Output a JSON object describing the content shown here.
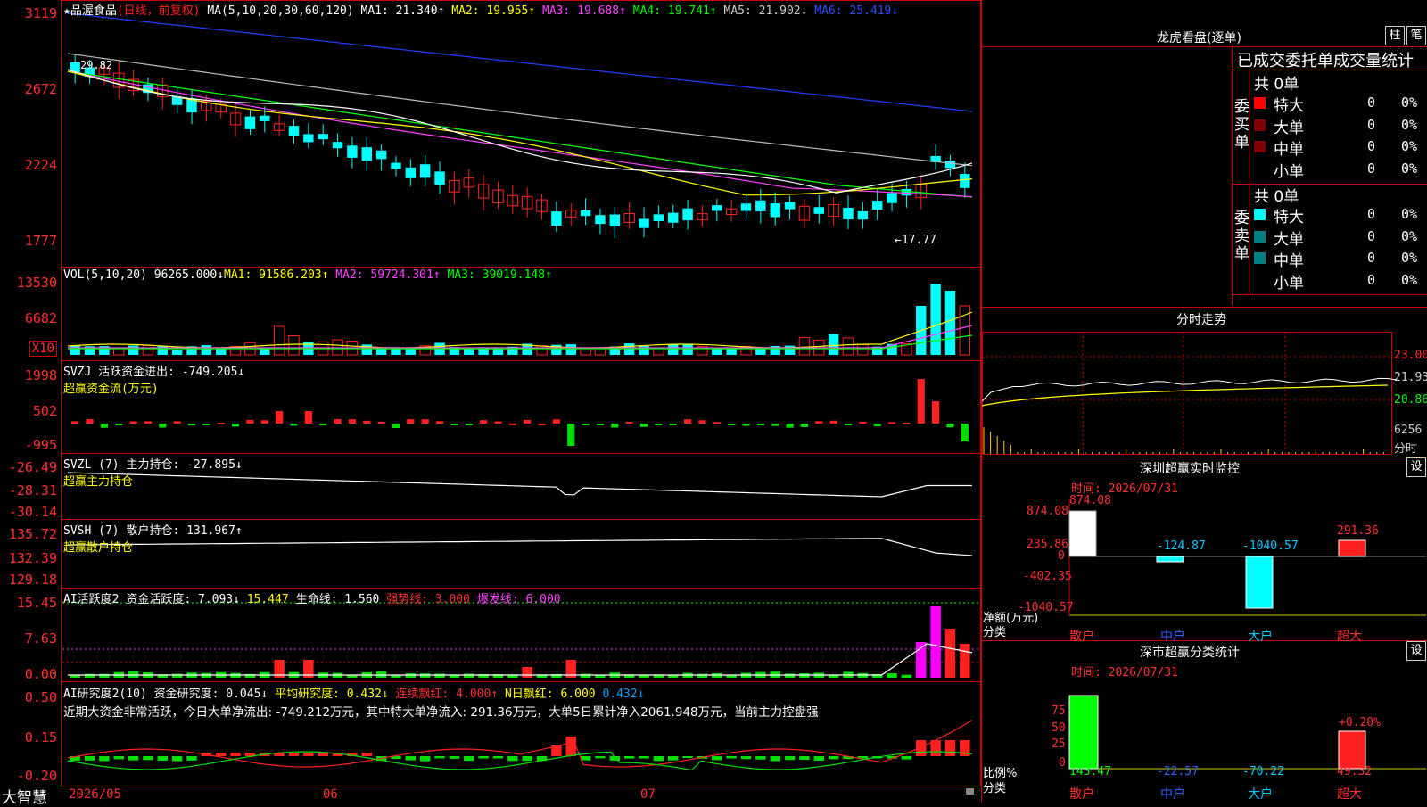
{
  "app_name": "大智慧",
  "main_chart": {
    "title_stock": "★品渥食品",
    "title_mode": "(日线，前复权)",
    "ma_label": "MA(5,10,20,30,60,120)",
    "ma1": "MA1: 21.340↑",
    "ma2": "MA2: 19.955↑",
    "ma3": "MA3: 19.688↑",
    "ma4": "MA4: 19.741↑",
    "ma5": "MA5: 21.902↓",
    "ma6": "MA6: 25.419↓",
    "y_ticks": [
      "3119",
      "2672",
      "2224",
      "1777"
    ],
    "high_label": "29.82",
    "low_label": "←17.77"
  },
  "vol_panel": {
    "label": "VOL(5,10,20)",
    "value": "96265.000↓",
    "ma1": "MA1: 91586.203↑",
    "ma2": "MA2: 59724.301↑",
    "ma3": "MA3: 39019.148↑",
    "y_ticks": [
      "13530",
      "6682"
    ],
    "unit": "X10"
  },
  "svzj_panel": {
    "label": "SVZJ",
    "value": "活跃资金进出: -749.205↓",
    "sub": "超赢资金流(万元)",
    "y_ticks": [
      "1998",
      "502",
      "-995"
    ]
  },
  "svzl_panel": {
    "label": "SVZL (7)",
    "value": "主力持仓: -27.895↓",
    "sub": "超赢主力持仓",
    "y_ticks": [
      "-26.49",
      "-28.31",
      "-30.14"
    ]
  },
  "svsh_panel": {
    "label": "SVSH (7)",
    "value": "散户持仓: 131.967↑",
    "sub": "超赢散户持仓",
    "y_ticks": [
      "135.72",
      "132.39",
      "129.18"
    ]
  },
  "ai_act_panel": {
    "label": "AI活跃度2",
    "value1": "资金活跃度: 7.093↓",
    "value2": "15.447",
    "value3": "生命线: 1.560",
    "value4": "强势线: 3.000",
    "value5": "爆发线: 6.000",
    "y_ticks": [
      "15.45",
      "7.63",
      "0.00"
    ]
  },
  "ai_res_panel": {
    "label": "AI研究度2(10)",
    "value1": "资金研究度: 0.045↓",
    "value2": "平均研究度: 0.432↓",
    "value3": "连续飘红: 4.000↑",
    "value4": "N日飘红: 6.000",
    "value5": "0.432↓",
    "comment": "近期大资金非常活跃，今日大单净流出: -749.212万元，其中特大单净流入: 291.36万元，大单5日累计净入2061.948万元，当前主力控盘强",
    "y_ticks": [
      "0.50",
      "0.15",
      "-0.20"
    ]
  },
  "date_axis": [
    "2026/05",
    "06",
    "07"
  ],
  "right": {
    "lhb_title": "龙虎看盘(逐单)",
    "btn_zhu": "柱",
    "btn_bi": "笔",
    "tabs_line": "已成交委托单成交量统计",
    "buy_side": "委买单",
    "sell_side": "委卖单",
    "buy_total": "共 0单",
    "sell_total": "共 0单",
    "rows": [
      {
        "label": "特大",
        "value": "0",
        "pct": "0%"
      },
      {
        "label": "大单",
        "value": "0",
        "pct": "0%"
      },
      {
        "label": "中单",
        "value": "0",
        "pct": "0%"
      },
      {
        "label": "小单",
        "value": "0",
        "pct": "0%"
      }
    ],
    "colors": {
      "buy": [
        "#ff0000",
        "#800000",
        "#800000",
        "#000000"
      ],
      "sell": [
        "#00ffff",
        "#008080",
        "#008080",
        "#000000"
      ]
    },
    "fs_title": "分时走势",
    "fs_ticks": [
      "23.00",
      "21.93",
      "20.86"
    ],
    "fs_vol": "6256",
    "fs_unit": "分时",
    "monitor_title": "深圳超赢实时监控",
    "monitor_set": "设",
    "monitor_time": "时间: 2026/07/31",
    "monitor_ticks": [
      "874.08",
      "235.86",
      "0",
      "-402.35",
      "-1040.57"
    ],
    "monitor_values": [
      "874.08",
      "-124.87",
      "-1040.57",
      "291.36"
    ],
    "monitor_unit": "净额(万元)",
    "monitor_cat": "分类",
    "categories": [
      "散户",
      "中户",
      "大户",
      "超大"
    ],
    "stat_title": "深市超赢分类统计",
    "stat_set": "设",
    "stat_time": "时间: 2026/07/31",
    "stat_ticks": [
      "75",
      "50",
      "25",
      "0"
    ],
    "stat_unit": "比例%",
    "stat_cat": "分类",
    "stat_values": [
      "143.47",
      "-22.57",
      "-70.22",
      "49.32"
    ],
    "stat_label": "+0.20%"
  }
}
